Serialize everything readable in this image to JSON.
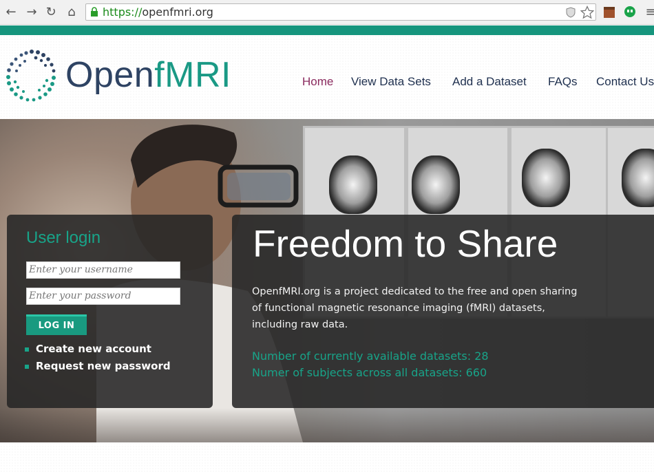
{
  "browser": {
    "url_protocol": "https://",
    "url_host": "openfmri.org",
    "back_icon": "back-arrow-icon",
    "forward_icon": "forward-arrow-icon",
    "reload_icon": "reload-icon",
    "home_icon": "home-icon"
  },
  "brand": {
    "name_part1": "Open",
    "name_part2": "fMRI",
    "accent_color": "#16957d",
    "dark_color": "#2e4363"
  },
  "nav": {
    "items": [
      {
        "label": "Home",
        "active": true
      },
      {
        "label": "View Data Sets",
        "active": false
      },
      {
        "label": "Add a Dataset",
        "active": false
      },
      {
        "label": "FAQs",
        "active": false
      },
      {
        "label": "Contact Us",
        "active": false
      }
    ]
  },
  "login": {
    "title": "User login",
    "username_placeholder": "Enter your username",
    "password_placeholder": "Enter your password",
    "button_label": "LOG IN",
    "links": [
      "Create new account",
      "Request new password"
    ]
  },
  "intro": {
    "title": "Freedom to Share",
    "body": "OpenfMRI.org is a project dedicated to the free and open sharing of functional magnetic resonance imaging (fMRI) datasets, including raw data.",
    "stats": [
      {
        "label": "Number of currently available datasets:",
        "value": "28"
      },
      {
        "label": "Numer of subjects across all datasets:",
        "value": "660"
      }
    ]
  }
}
